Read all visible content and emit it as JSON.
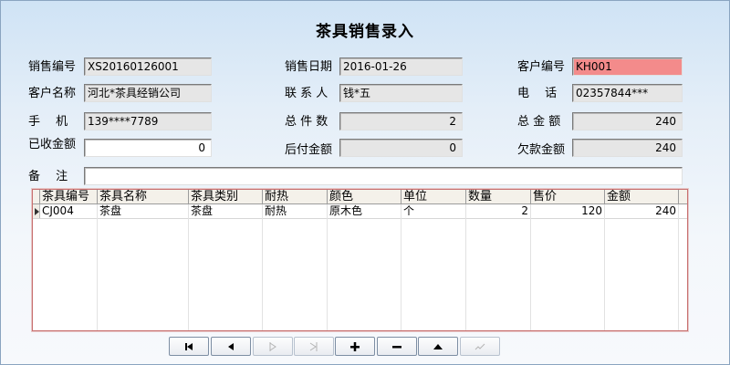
{
  "title": "茶具销售录入",
  "form": {
    "sale_no_label": "销售编号",
    "sale_no": "XS20160126001",
    "sale_date_label": "销售日期",
    "sale_date": "2016-01-26",
    "customer_no_label": "客户编号",
    "customer_no": "KH001",
    "customer_name_label": "客户名称",
    "customer_name": "河北*茶具经销公司",
    "contact_label": "联 系 人",
    "contact": "钱*五",
    "phone_label": "电　 话",
    "phone": "02357844***",
    "mobile_label": "手　 机",
    "mobile": "139****7789",
    "total_qty_label": "总 件 数",
    "total_qty": "2",
    "total_amount_label": "总 金 额",
    "total_amount": "240",
    "received_label": "已收金额",
    "received": "0",
    "deferred_label": "后付金额",
    "deferred": "0",
    "owed_label": "欠款金额",
    "owed": "240",
    "remark_label": "备　 注",
    "remark": ""
  },
  "grid": {
    "columns": [
      "茶具编号",
      "茶具名称",
      "茶具类别",
      "耐热",
      "颜色",
      "单位",
      "数量",
      "售价",
      "金额"
    ],
    "rows": [
      [
        "CJ004",
        "茶盘",
        "茶盘",
        "耐热",
        "原木色",
        "个",
        "2",
        "120",
        "240"
      ]
    ]
  },
  "nav": {
    "first_icon": "first-record-icon",
    "prev_icon": "previous-record-icon",
    "next_icon": "next-record-icon",
    "last_icon": "last-record-icon",
    "add_icon": "add-record-icon",
    "delete_icon": "delete-record-icon",
    "save_icon": "save-record-icon",
    "confirm_icon": "confirm-icon"
  }
}
